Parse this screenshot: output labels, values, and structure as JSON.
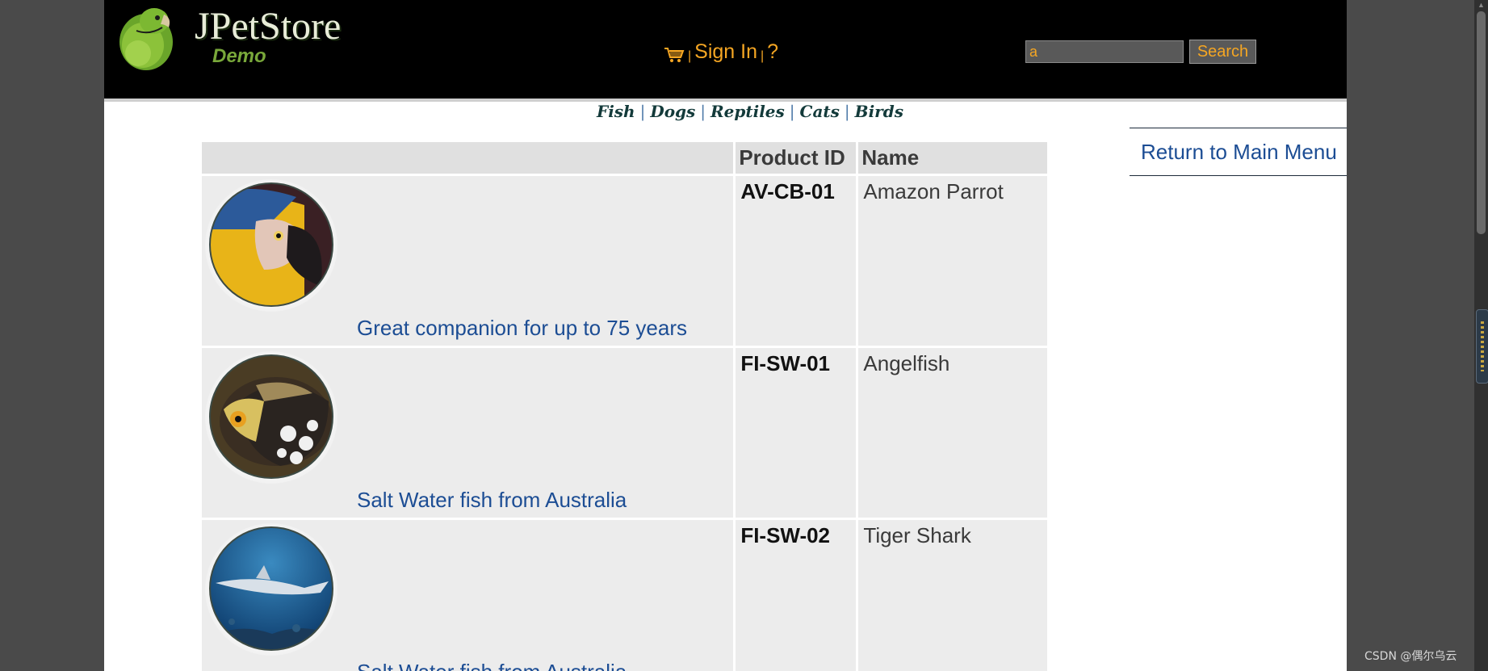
{
  "header": {
    "logo_title": "JPetStore",
    "logo_subtitle": "Demo",
    "menu": {
      "separator": "|",
      "sign_in_label": "Sign In",
      "help_label": "?"
    },
    "search": {
      "value": "a",
      "button_label": "Search"
    }
  },
  "quicklinks": [
    "Fish",
    "Dogs",
    "Reptiles",
    "Cats",
    "Birds"
  ],
  "quicklink_separator": "|",
  "return_link": "Return to Main Menu",
  "table": {
    "headers": [
      "",
      "Product ID",
      "Name"
    ],
    "rows": [
      {
        "image": "parrot",
        "description": "Great companion for up to 75 years",
        "product_id": "AV-CB-01",
        "name": "Amazon Parrot"
      },
      {
        "image": "angelfish",
        "description": "Salt Water fish from Australia",
        "product_id": "FI-SW-01",
        "name": "Angelfish"
      },
      {
        "image": "shark",
        "description": "Salt Water fish from Australia",
        "product_id": "FI-SW-02",
        "name": "Tiger Shark"
      }
    ]
  },
  "watermark": "CSDN @偶尔乌云"
}
